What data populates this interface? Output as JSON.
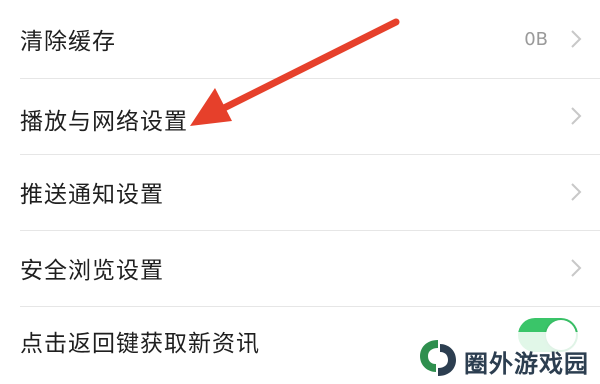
{
  "settings": {
    "items": [
      {
        "label": "清除缓存",
        "value": "0B"
      },
      {
        "label": "播放与网络设置"
      },
      {
        "label": "推送通知设置"
      },
      {
        "label": "安全浏览设置"
      },
      {
        "label": "点击返回键获取新资讯"
      }
    ],
    "toggle_on": true
  },
  "colors": {
    "arrow": "#e6402b",
    "toggle": "#3ac569",
    "logo": "#2f8f4e"
  },
  "icons": [
    "chevron-right-icon",
    "red-pointer-arrow",
    "leaf-logo-icon"
  ],
  "watermark": {
    "text": "圈外游戏园"
  }
}
